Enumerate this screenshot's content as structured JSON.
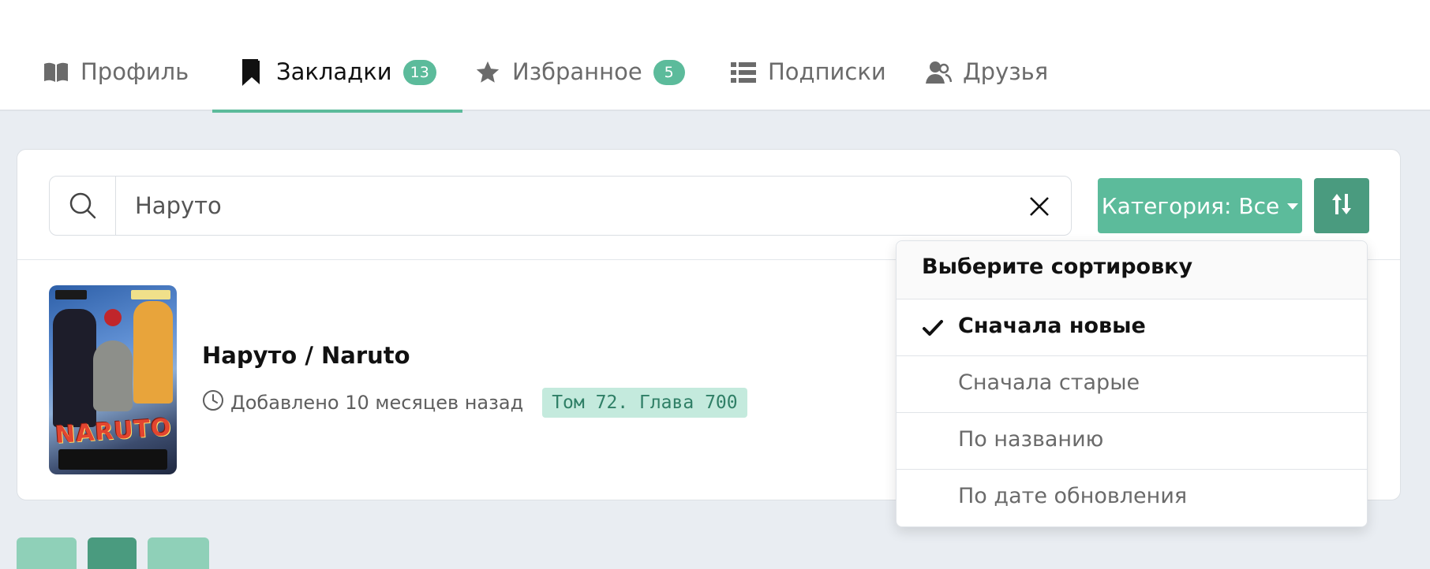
{
  "tabs": [
    {
      "label": "Профиль",
      "icon": "book-open-icon",
      "active": false
    },
    {
      "label": "Закладки",
      "icon": "bookmark-icon",
      "active": true,
      "count": "13"
    },
    {
      "label": "Избранное",
      "icon": "star-icon",
      "active": false,
      "count": "5"
    },
    {
      "label": "Подписки",
      "icon": "list-icon",
      "active": false
    },
    {
      "label": "Друзья",
      "icon": "users-icon",
      "active": false
    }
  ],
  "search": {
    "value": "Наруто",
    "icon": "search-icon",
    "clear_icon": "close-icon"
  },
  "filters": {
    "category_label": "Категория: Все",
    "sort_icon": "sort-arrows-icon"
  },
  "bookmark": {
    "title": "Наруто / Naruto",
    "added": "Добавлено 10 месяцев назад",
    "chapter": "Том 72. Глава 700",
    "cover_logo": "NARUTO"
  },
  "sort_menu": {
    "header": "Выберите сортировку",
    "options": [
      {
        "label": "Сначала новые",
        "selected": true
      },
      {
        "label": "Сначала старые",
        "selected": false
      },
      {
        "label": "По названию",
        "selected": false
      },
      {
        "label": "По дате обновления",
        "selected": false
      }
    ]
  },
  "colors": {
    "accent": "#5cbb9b",
    "accent_dark": "#4a9b7f",
    "chip_bg": "#c4eadd",
    "page_bg": "#e9edf2"
  }
}
